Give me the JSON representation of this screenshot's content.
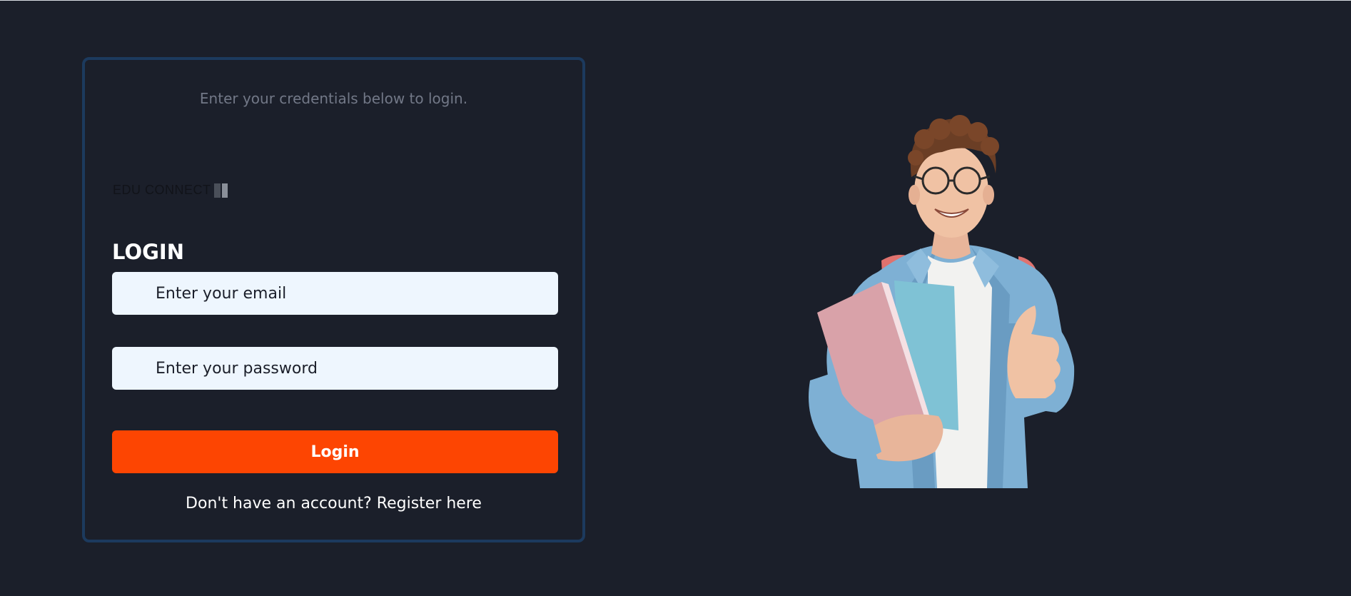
{
  "login": {
    "subtitle": "Enter your credentials below to login.",
    "brand": "EDU CONNECT",
    "heading": "LOGIN",
    "email_placeholder": "Enter your email",
    "password_placeholder": "Enter your password",
    "submit_label": "Login",
    "register_prompt": "Don't have an account?",
    "register_link": "Register here"
  },
  "colors": {
    "background": "#1b1f2a",
    "card_border": "#1c3a5e",
    "input_background": "#eef6fe",
    "button": "#fd4502"
  },
  "hero_image": {
    "icon": "student-with-books-thumbs-up"
  }
}
